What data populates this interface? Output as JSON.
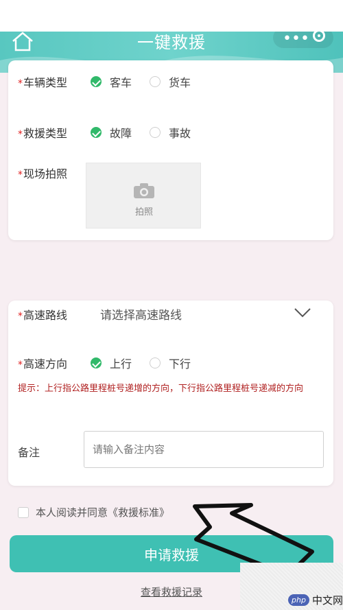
{
  "header": {
    "title": "一键救援"
  },
  "form1": {
    "vehicle_type": {
      "label": "车辆类型",
      "options": [
        "客车",
        "货车"
      ],
      "selected": "客车"
    },
    "rescue_type": {
      "label": "救援类型",
      "options": [
        "故障",
        "事故"
      ],
      "selected": "故障"
    },
    "photo": {
      "label": "现场拍照",
      "button": "拍照"
    }
  },
  "form2": {
    "route": {
      "label": "高速路线",
      "placeholder": "请选择高速路线"
    },
    "direction": {
      "label": "高速方向",
      "options": [
        "上行",
        "下行"
      ],
      "selected": "上行"
    },
    "tip": "提示：上行指公路里程桩号递增的方向，下行指公路里程桩号递减的方向",
    "remark": {
      "label": "备注",
      "placeholder": "请输入备注内容"
    }
  },
  "agreement": {
    "text": "本人阅读并同意《救援标准》"
  },
  "actions": {
    "submit": "申请救援",
    "records": "查看救援记录"
  },
  "watermark": {
    "brand": "php",
    "text": "中文网"
  },
  "colors": {
    "primary": "#3fc0b3",
    "header": "#58c7c0",
    "radio_on": "#31b96a",
    "required": "#e02020",
    "tip": "#b02020"
  }
}
